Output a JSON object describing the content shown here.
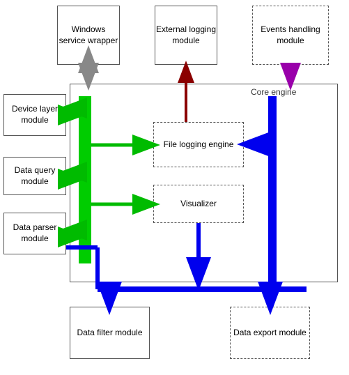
{
  "boxes": {
    "windows_service": "Windows service wrapper",
    "external_logging": "External logging module",
    "events_handling": "Events handling module",
    "core_engine": "Core engine",
    "device_layer": "Device layer module",
    "data_query": "Data query module",
    "data_parser": "Data parser module",
    "file_logging": "File logging engine",
    "visualizer": "Visualizer",
    "data_filter": "Data filter module",
    "data_export": "Data export module"
  }
}
